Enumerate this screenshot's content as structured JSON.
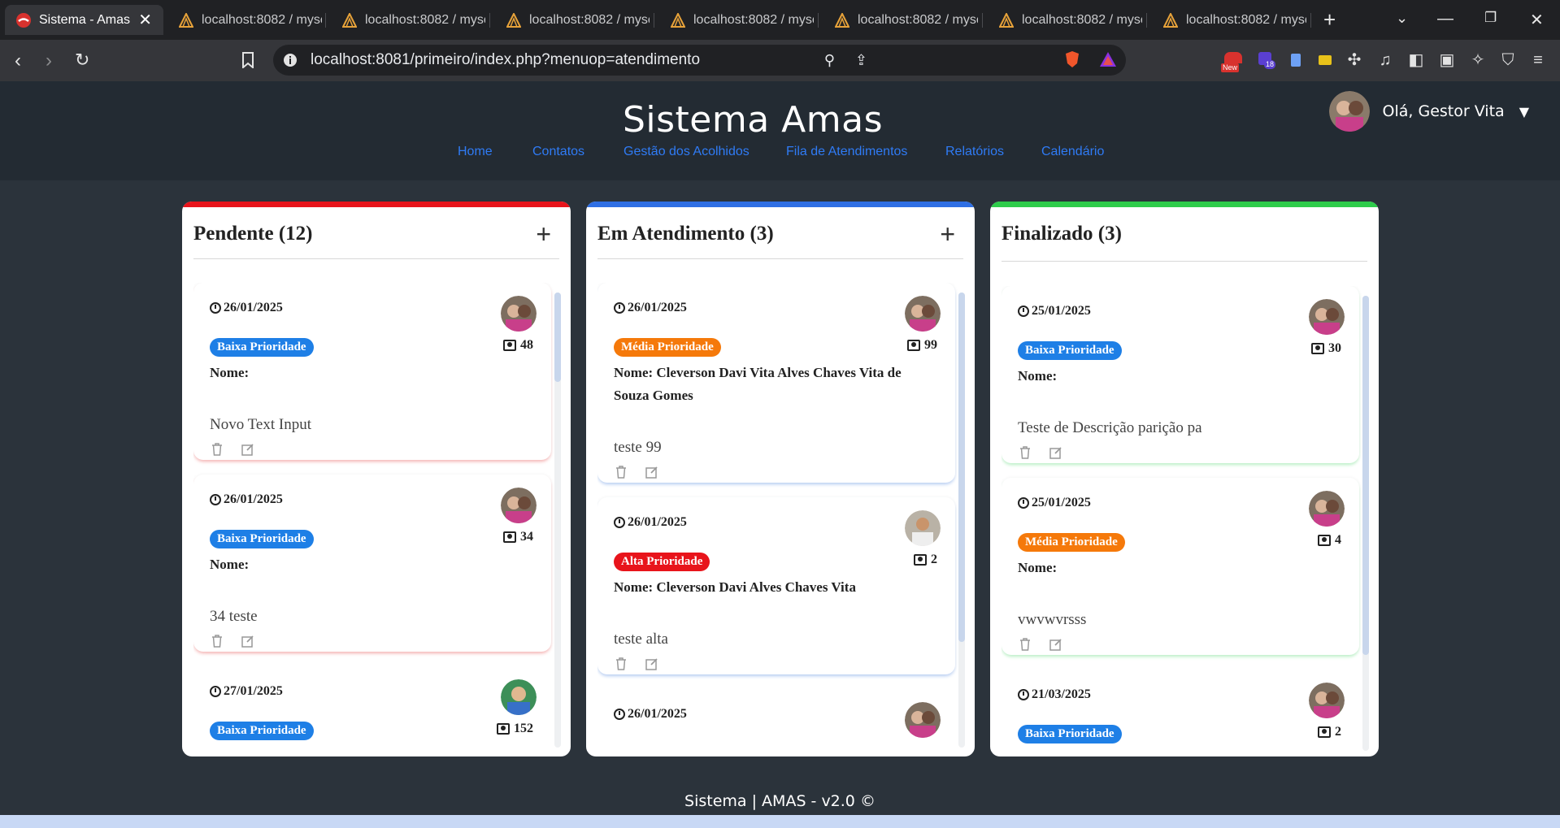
{
  "browser": {
    "tabs": [
      {
        "title": "Sistema - Amas",
        "active": true
      },
      {
        "title": "localhost:8082 / mysc",
        "active": false
      },
      {
        "title": "localhost:8082 / mysc",
        "active": false
      },
      {
        "title": "localhost:8082 / mysc",
        "active": false
      },
      {
        "title": "localhost:8082 / mysc",
        "active": false
      },
      {
        "title": "localhost:8082 / mysc",
        "active": false
      },
      {
        "title": "localhost:8082 / mysc",
        "active": false
      },
      {
        "title": "localhost:8082 / mysc",
        "active": false
      }
    ],
    "new_tab": "+",
    "url": "localhost:8081/primeiro/index.php?menuop=atendimento",
    "badges": {
      "new": "New",
      "count": "18"
    }
  },
  "header": {
    "title": "Sistema Amas",
    "user_greeting": "Olá, Gestor Vita",
    "nav": [
      "Home",
      "Contatos",
      "Gestão dos Acolhidos",
      "Fila de Atendimentos",
      "Relatórios",
      "Calendário"
    ]
  },
  "colors": {
    "pendente": "#e8141b",
    "em_atendimento": "#2f6fe4",
    "finalizado": "#2ecc4b",
    "baixa": "#1e7fe6",
    "media": "#f5790a",
    "alta": "#e8141b"
  },
  "columns": [
    {
      "title": "Pendente (12)",
      "add": "+",
      "cards": [
        {
          "date": "26/01/2025",
          "priority": "Baixa Prioridade",
          "count": "48",
          "name": "Nome:",
          "desc": "Novo Text Input"
        },
        {
          "date": "26/01/2025",
          "priority": "Baixa Prioridade",
          "count": "34",
          "name": "Nome:",
          "desc": "34 teste"
        },
        {
          "date": "27/01/2025",
          "priority": "Baixa Prioridade",
          "count": "152",
          "name": "",
          "desc": ""
        }
      ]
    },
    {
      "title": "Em Atendimento (3)",
      "add": "+",
      "cards": [
        {
          "date": "26/01/2025",
          "priority": "Média Prioridade",
          "count": "99",
          "name": "Nome: Cleverson Davi Vita Alves Chaves Vita de Souza Gomes",
          "desc": "teste 99"
        },
        {
          "date": "26/01/2025",
          "priority": "Alta Prioridade",
          "count": "2",
          "name": "Nome: Cleverson Davi Alves Chaves Vita",
          "desc": "teste alta"
        },
        {
          "date": "26/01/2025",
          "priority": "",
          "count": "",
          "name": "",
          "desc": ""
        }
      ]
    },
    {
      "title": "Finalizado (3)",
      "add": "",
      "cards": [
        {
          "date": "25/01/2025",
          "priority": "Baixa Prioridade",
          "count": "30",
          "name": "Nome:",
          "desc": "Teste de Descrição parição pa"
        },
        {
          "date": "25/01/2025",
          "priority": "Média Prioridade",
          "count": "4",
          "name": "Nome:",
          "desc": "vwvwvrsss"
        },
        {
          "date": "21/03/2025",
          "priority": "Baixa Prioridade",
          "count": "2",
          "name": "",
          "desc": ""
        }
      ]
    }
  ],
  "footer": "Sistema | AMAS - v2.0 ©"
}
